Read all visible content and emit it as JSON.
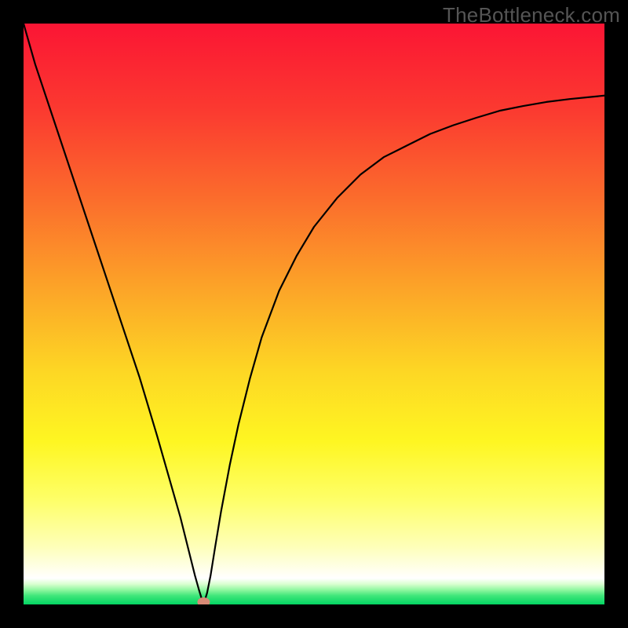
{
  "watermark": "TheBottleneck.com",
  "chart_data": {
    "type": "line",
    "title": "",
    "xlabel": "",
    "ylabel": "",
    "xlim": [
      0,
      100
    ],
    "ylim": [
      0,
      100
    ],
    "series": [
      {
        "name": "bottleneck-curve",
        "x": [
          0,
          2,
          5,
          8,
          11,
          14,
          17,
          20,
          23,
          25,
          27,
          28.5,
          29.5,
          30.2,
          30.6,
          30.8,
          31,
          31.2,
          31.6,
          32.2,
          33,
          34,
          35.5,
          37,
          39,
          41,
          44,
          47,
          50,
          54,
          58,
          62,
          66,
          70,
          74,
          78,
          82,
          86,
          90,
          94,
          98,
          100
        ],
        "y": [
          100,
          93,
          84,
          75,
          66,
          57,
          48,
          39,
          29,
          22,
          15,
          9,
          5,
          2.5,
          1.2,
          0.5,
          0.2,
          0.7,
          2.0,
          5,
          10,
          16,
          24,
          31,
          39,
          46,
          54,
          60,
          65,
          70,
          74,
          77,
          79,
          81,
          82.5,
          83.8,
          85,
          85.8,
          86.5,
          87,
          87.4,
          87.6
        ]
      }
    ],
    "marker": {
      "x": 31,
      "y": 0.4,
      "label": "optimal-point"
    },
    "gradient_stops": [
      {
        "offset": 0.0,
        "color": "#fb1534"
      },
      {
        "offset": 0.15,
        "color": "#fb3a30"
      },
      {
        "offset": 0.3,
        "color": "#fb6c2c"
      },
      {
        "offset": 0.45,
        "color": "#fca228"
      },
      {
        "offset": 0.6,
        "color": "#fdd724"
      },
      {
        "offset": 0.72,
        "color": "#fef622"
      },
      {
        "offset": 0.82,
        "color": "#feff68"
      },
      {
        "offset": 0.9,
        "color": "#feffb8"
      },
      {
        "offset": 0.955,
        "color": "#ffffff"
      },
      {
        "offset": 0.965,
        "color": "#d9ffd0"
      },
      {
        "offset": 0.975,
        "color": "#8ff7a0"
      },
      {
        "offset": 0.985,
        "color": "#3fe67a"
      },
      {
        "offset": 1.0,
        "color": "#04d562"
      }
    ]
  }
}
